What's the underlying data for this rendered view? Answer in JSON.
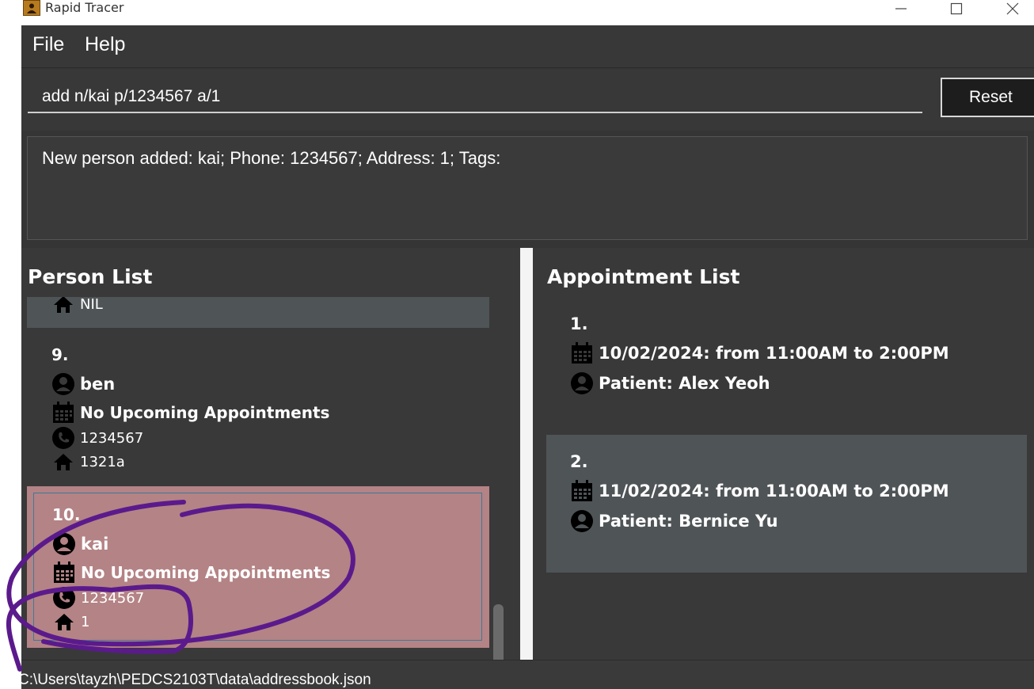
{
  "window": {
    "title": "Rapid Tracer"
  },
  "menu": {
    "file": "File",
    "help": "Help"
  },
  "command": {
    "value": "add n/kai p/1234567 a/1",
    "reset_label": "Reset"
  },
  "result": {
    "text": "New person added: kai; Phone: 1234567; Address: 1; Tags:"
  },
  "person_list": {
    "title": "Person List",
    "partial_address": "NIL",
    "items": [
      {
        "index": "9.",
        "name": "ben",
        "appointment": "No Upcoming Appointments",
        "phone": "1234567",
        "address": "1321a"
      },
      {
        "index": "10.",
        "name": "kai",
        "appointment": "No Upcoming Appointments",
        "phone": "1234567",
        "address": "1"
      }
    ]
  },
  "appointment_list": {
    "title": "Appointment List",
    "items": [
      {
        "index": "1.",
        "datetime": "10/02/2024: from 11:00AM to 2:00PM",
        "patient": "Patient: Alex Yeoh"
      },
      {
        "index": "2.",
        "datetime": "11/02/2024: from 11:00AM to 2:00PM",
        "patient": "Patient: Bernice Yu"
      }
    ]
  },
  "status": {
    "path": "C:\\Users\\tayzh\\PEDCS2103T\\data\\addressbook.json"
  },
  "colors": {
    "selected_card": "#b48385",
    "card_alt": "#4f5457",
    "annotation": "#5b1a8c"
  }
}
